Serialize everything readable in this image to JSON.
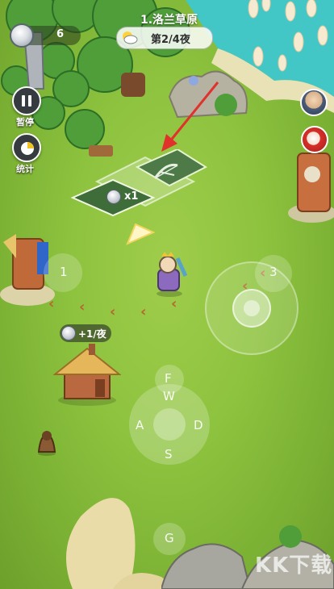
{
  "hud": {
    "coin_count": "6",
    "map_name": "1.洛兰草原",
    "night_progress": "第2/4夜"
  },
  "left_controls": {
    "pause_label": "暂停",
    "stats_label": "统计"
  },
  "build_spots": {
    "tile_cost": "x1",
    "house_income": "+1/夜"
  },
  "ground_markers": {
    "left_marker": "1",
    "right_marker": "3"
  },
  "keys": {
    "up": "F",
    "w": "W",
    "a": "A",
    "d": "D",
    "s": "S",
    "g": "G"
  },
  "watermark": "KK下载",
  "colors": {
    "grass": "#8ec33f",
    "arrow": "#e0322b",
    "hud_dark": "#353b3f"
  },
  "icons": {
    "coin": "silver-coin-icon",
    "weather": "cloudy-sun-icon",
    "pause": "pause-icon",
    "stats": "pie-chart-icon",
    "build": "bow-icon",
    "direction": "pointer-arrow-icon"
  }
}
